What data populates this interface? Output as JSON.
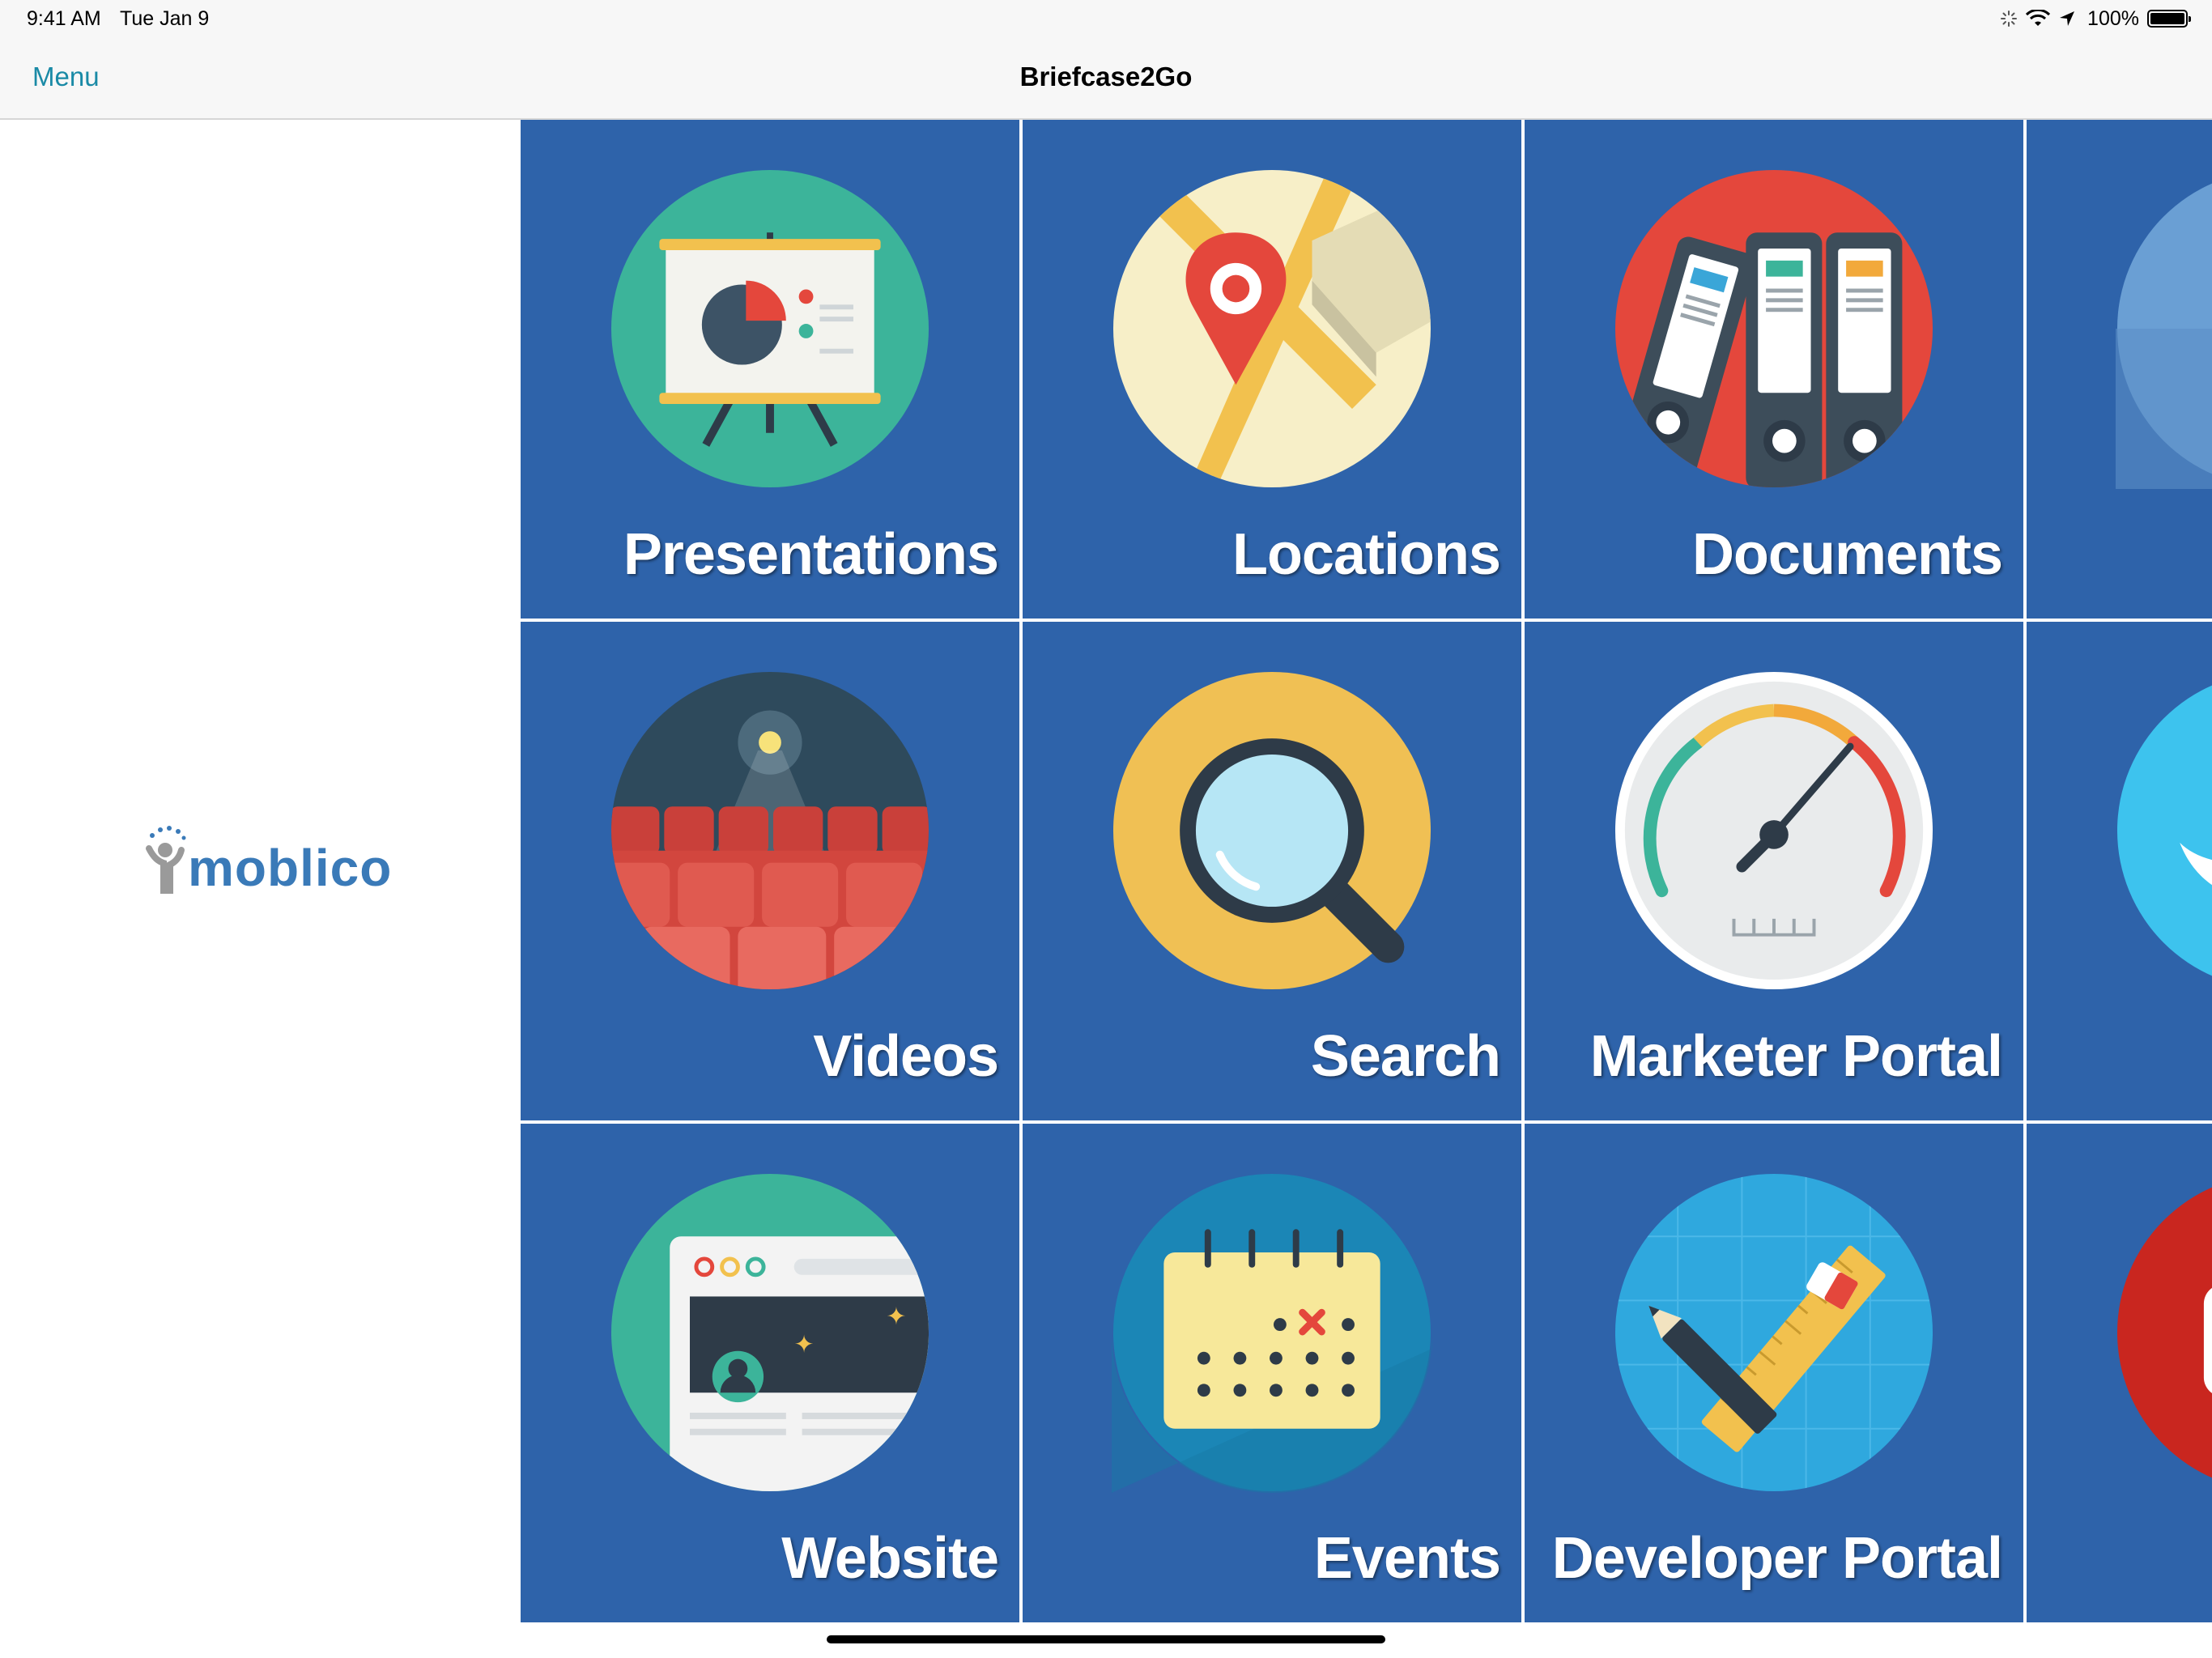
{
  "status_bar": {
    "time": "9:41 AM",
    "date": "Tue Jan 9",
    "battery": "100%",
    "icons": [
      "activity-spinner-icon",
      "wifi-icon",
      "location-arrow-icon",
      "battery-icon"
    ]
  },
  "nav": {
    "menu_label": "Menu",
    "title": "Briefcase2Go"
  },
  "sidebar": {
    "logo_text": "moblico"
  },
  "tiles": [
    {
      "label": "Presentations",
      "icon": "presentation-board-icon"
    },
    {
      "label": "Locations",
      "icon": "map-pin-icon"
    },
    {
      "label": "Documents",
      "icon": "binders-icon"
    },
    {
      "label": "",
      "icon": "globe-partial-icon"
    },
    {
      "label": "Videos",
      "icon": "theater-icon"
    },
    {
      "label": "Search",
      "icon": "magnifier-icon"
    },
    {
      "label": "Marketer Portal",
      "icon": "gauge-icon"
    },
    {
      "label": "",
      "icon": "twitter-partial-icon"
    },
    {
      "label": "Website",
      "icon": "browser-window-icon"
    },
    {
      "label": "Events",
      "icon": "calendar-icon"
    },
    {
      "label": "Developer Portal",
      "icon": "ruler-pencil-icon"
    },
    {
      "label": "",
      "icon": "youtube-partial-icon"
    }
  ],
  "colors": {
    "tile_bg": "#2e63aa",
    "accent": "#1a8aa6",
    "logo": "#3a7ab8"
  }
}
